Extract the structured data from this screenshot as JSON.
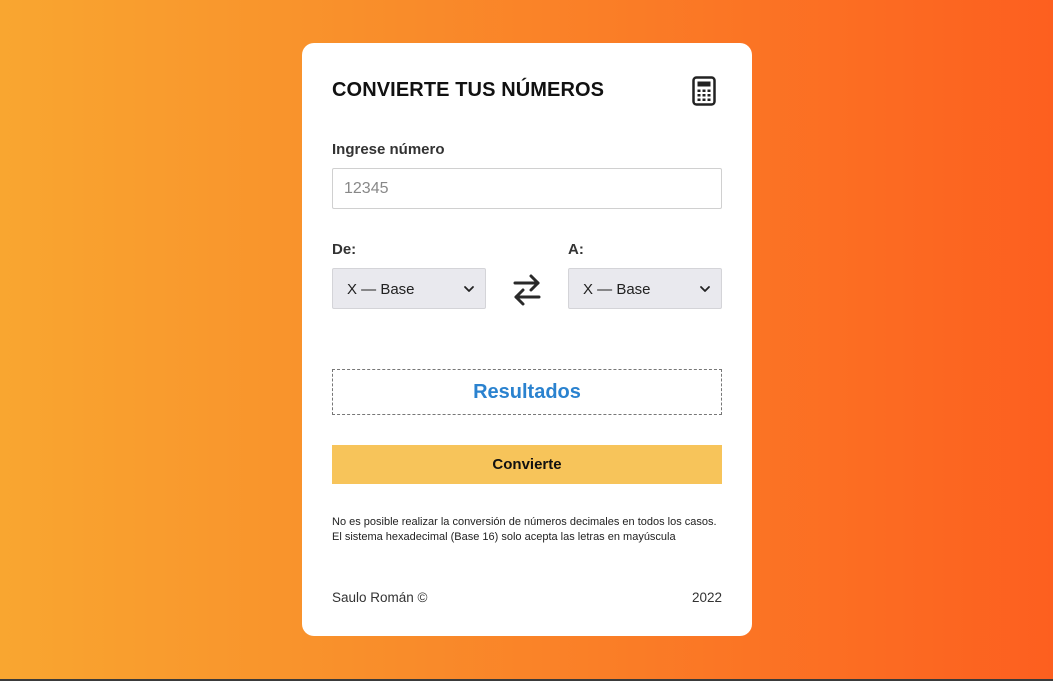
{
  "card": {
    "title": "CONVIERTE TUS NÚMEROS",
    "icon": "calculator-icon"
  },
  "number_input": {
    "label": "Ingrese número",
    "value": "",
    "placeholder": "12345"
  },
  "from": {
    "label": "De:",
    "selected": "X — Base"
  },
  "to": {
    "label": "A:",
    "selected": "X — Base"
  },
  "swap": {
    "icon": "swap-arrows-icon"
  },
  "results": {
    "text": "Resultados"
  },
  "convert_button": {
    "label": "Convierte"
  },
  "notes": {
    "line1": "No es posible realizar la conversión de números decimales en todos los casos.",
    "line2": "El sistema hexadecimal (Base 16) solo acepta las letras en mayúscula"
  },
  "footer": {
    "author": "Saulo Román ©",
    "year": "2022"
  },
  "colors": {
    "gradient_start": "#f9a630",
    "gradient_end": "#fd5f1f",
    "results_text": "#2a82cf",
    "button_bg": "#f7c45a"
  }
}
